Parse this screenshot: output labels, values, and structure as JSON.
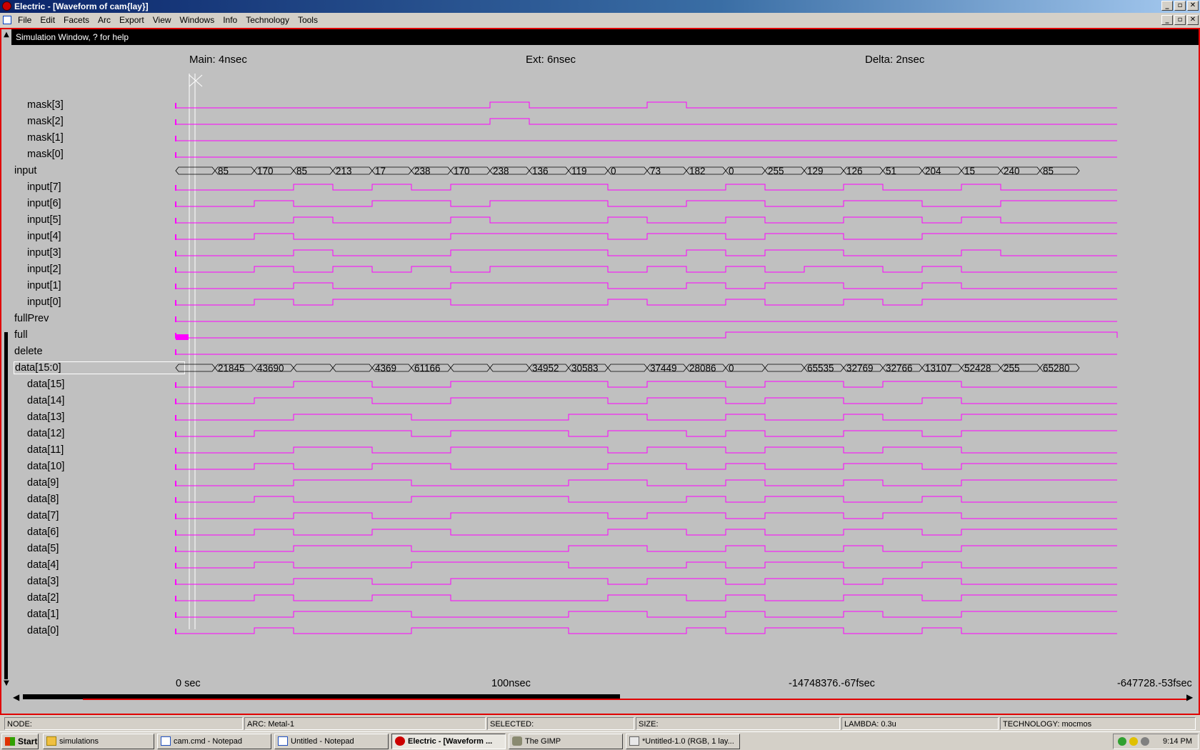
{
  "window": {
    "title": "Electric - [Waveform of cam{lay}]",
    "min": "_",
    "max": "▫",
    "close": "✕"
  },
  "menu": [
    "File",
    "Edit",
    "Facets",
    "Arc",
    "Export",
    "View",
    "Windows",
    "Info",
    "Technology",
    "Tools"
  ],
  "sim": {
    "header": "Simulation Window, ? for help",
    "cursors": {
      "main": "Main: 4nsec",
      "ext": "Ext: 6nsec",
      "delta": "Delta: 2nsec"
    },
    "axis": [
      "0 sec",
      "100nsec",
      "-14748376.-67fsec",
      "-647728.-53fsec"
    ],
    "accent_color": "#ff00ff",
    "signals": [
      {
        "name": "mask[3]",
        "kind": "bit",
        "indent": true,
        "transitions": [
          8,
          9,
          12,
          13
        ]
      },
      {
        "name": "mask[2]",
        "kind": "bit",
        "indent": true,
        "transitions": [
          8,
          9
        ]
      },
      {
        "name": "mask[1]",
        "kind": "bit",
        "indent": true,
        "transitions": []
      },
      {
        "name": "mask[0]",
        "kind": "bit",
        "indent": true,
        "transitions": []
      },
      {
        "name": "input",
        "kind": "bus",
        "indent": false,
        "values": [
          "",
          "85",
          "170",
          "85",
          "213",
          "17",
          "238",
          "170",
          "238",
          "136",
          "119",
          "0",
          "73",
          "182",
          "0",
          "255",
          "129",
          "126",
          "51",
          "204",
          "15",
          "240",
          "85"
        ]
      },
      {
        "name": "input[7]",
        "kind": "bit",
        "indent": true,
        "transitions": [
          3,
          4,
          5,
          6,
          7,
          11,
          14,
          15,
          17,
          18,
          20,
          21
        ]
      },
      {
        "name": "input[6]",
        "kind": "bit",
        "indent": true,
        "transitions": [
          2,
          3,
          5,
          7,
          8,
          11,
          13,
          15,
          17,
          19,
          21
        ]
      },
      {
        "name": "input[5]",
        "kind": "bit",
        "indent": true,
        "transitions": [
          3,
          4,
          7,
          8,
          11,
          12,
          14,
          15,
          17,
          19,
          20,
          21
        ]
      },
      {
        "name": "input[4]",
        "kind": "bit",
        "indent": true,
        "transitions": [
          2,
          3,
          7,
          11,
          12,
          14,
          15,
          17,
          19
        ]
      },
      {
        "name": "input[3]",
        "kind": "bit",
        "indent": true,
        "transitions": [
          3,
          4,
          7,
          11,
          13,
          14,
          15,
          17,
          20,
          21
        ]
      },
      {
        "name": "input[2]",
        "kind": "bit",
        "indent": true,
        "transitions": [
          2,
          3,
          4,
          5,
          6,
          7,
          8,
          11,
          12,
          13,
          14,
          15,
          16,
          18,
          19,
          20
        ]
      },
      {
        "name": "input[1]",
        "kind": "bit",
        "indent": true,
        "transitions": [
          3,
          4,
          7,
          11,
          13,
          14,
          15,
          17,
          19,
          20
        ]
      },
      {
        "name": "input[0]",
        "kind": "bit",
        "indent": true,
        "transitions": [
          2,
          3,
          4,
          7,
          11,
          12,
          14,
          15,
          17,
          18,
          19
        ]
      },
      {
        "name": "fullPrev",
        "kind": "bit",
        "indent": false,
        "transitions": []
      },
      {
        "name": "full",
        "kind": "bit",
        "indent": false,
        "transitions": [
          14,
          24
        ]
      },
      {
        "name": "delete",
        "kind": "bit",
        "indent": false,
        "transitions": []
      },
      {
        "name": "data[15:0]",
        "kind": "bus",
        "indent": false,
        "selected": true,
        "values": [
          "",
          "21845",
          "43690",
          "",
          "",
          "4369",
          "61166",
          "",
          "",
          "34952",
          "30583",
          "",
          "37449",
          "28086",
          "0",
          "",
          "65535",
          "32769",
          "32766",
          "13107",
          "52428",
          "255",
          "65280"
        ]
      },
      {
        "name": "data[15]",
        "kind": "bit",
        "indent": true,
        "transitions": [
          3,
          5,
          7,
          11,
          12,
          14,
          15,
          17,
          18,
          20
        ]
      },
      {
        "name": "data[14]",
        "kind": "bit",
        "indent": true,
        "transitions": [
          2,
          5,
          7,
          11,
          12,
          14,
          15,
          17,
          19,
          20
        ]
      },
      {
        "name": "data[13]",
        "kind": "bit",
        "indent": true,
        "transitions": [
          3,
          6,
          10,
          12,
          14,
          15,
          17,
          18,
          20
        ]
      },
      {
        "name": "data[12]",
        "kind": "bit",
        "indent": true,
        "transitions": [
          2,
          6,
          7,
          10,
          11,
          13,
          14,
          15,
          17,
          19,
          20
        ]
      },
      {
        "name": "data[11]",
        "kind": "bit",
        "indent": true,
        "transitions": [
          3,
          5,
          7,
          11,
          12,
          14,
          15,
          17,
          18,
          20
        ]
      },
      {
        "name": "data[10]",
        "kind": "bit",
        "indent": true,
        "transitions": [
          2,
          3,
          5,
          7,
          11,
          13,
          14,
          15,
          17,
          19,
          20
        ]
      },
      {
        "name": "data[9]",
        "kind": "bit",
        "indent": true,
        "transitions": [
          3,
          6,
          10,
          12,
          14,
          15,
          17,
          18,
          20
        ]
      },
      {
        "name": "data[8]",
        "kind": "bit",
        "indent": true,
        "transitions": [
          2,
          3,
          6,
          10,
          13,
          14,
          15,
          17,
          19,
          20
        ]
      },
      {
        "name": "data[7]",
        "kind": "bit",
        "indent": true,
        "transitions": [
          3,
          5,
          7,
          11,
          12,
          14,
          15,
          17,
          18,
          20
        ]
      },
      {
        "name": "data[6]",
        "kind": "bit",
        "indent": true,
        "transitions": [
          2,
          3,
          5,
          7,
          11,
          13,
          14,
          15,
          17,
          19,
          20
        ]
      },
      {
        "name": "data[5]",
        "kind": "bit",
        "indent": true,
        "transitions": [
          3,
          6,
          10,
          12,
          14,
          15,
          17,
          18,
          20
        ]
      },
      {
        "name": "data[4]",
        "kind": "bit",
        "indent": true,
        "transitions": [
          2,
          3,
          6,
          10,
          13,
          14,
          15,
          17,
          19,
          20
        ]
      },
      {
        "name": "data[3]",
        "kind": "bit",
        "indent": true,
        "transitions": [
          3,
          5,
          7,
          11,
          12,
          14,
          15,
          17,
          18,
          20
        ]
      },
      {
        "name": "data[2]",
        "kind": "bit",
        "indent": true,
        "transitions": [
          2,
          3,
          5,
          7,
          11,
          13,
          14,
          15,
          17,
          19,
          20
        ]
      },
      {
        "name": "data[1]",
        "kind": "bit",
        "indent": true,
        "transitions": [
          3,
          6,
          10,
          12,
          14,
          15,
          17,
          18,
          20
        ]
      },
      {
        "name": "data[0]",
        "kind": "bit",
        "indent": true,
        "transitions": [
          2,
          3,
          6,
          10,
          13,
          14,
          15,
          17,
          19,
          20
        ]
      }
    ]
  },
  "status": {
    "node": "NODE:",
    "arc": "ARC: Metal-1",
    "selected": "SELECTED:",
    "size": "SIZE:",
    "lambda": "LAMBDA: 0.3u",
    "technology": "TECHNOLOGY: mocmos"
  },
  "taskbar": {
    "start": "Start",
    "tasks": [
      "simulations",
      "cam.cmd - Notepad",
      "Untitled - Notepad",
      "Electric - [Waveform ...",
      "The GIMP",
      "*Untitled-1.0 (RGB, 1 lay..."
    ],
    "clock": "9:14 PM"
  }
}
